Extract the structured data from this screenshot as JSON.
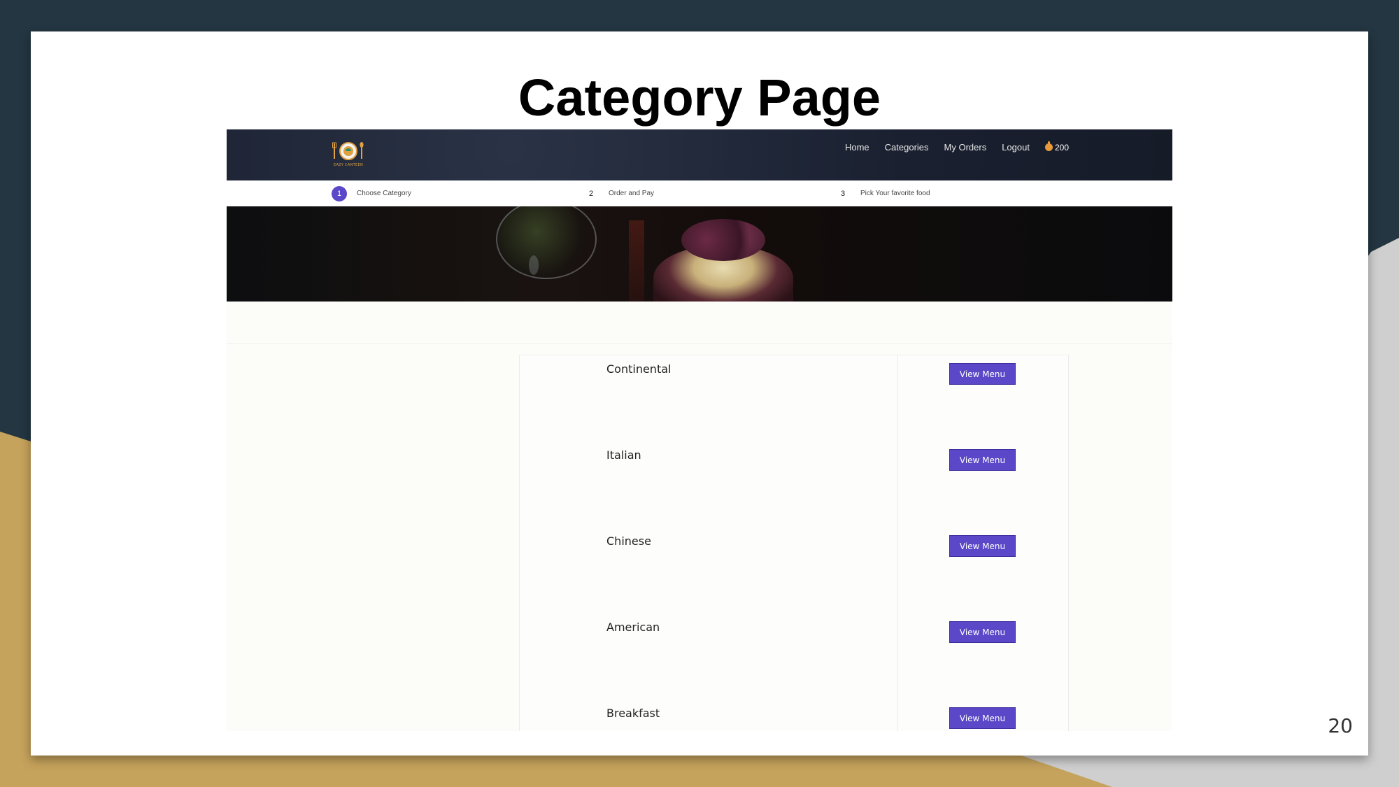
{
  "slide": {
    "title": "Category Page",
    "page_number": "20"
  },
  "app": {
    "logo_text": "EAZY CANTEEN",
    "nav": {
      "links": [
        "Home",
        "Categories",
        "My Orders",
        "Logout"
      ],
      "coins": "200"
    },
    "steps": [
      {
        "number": "1",
        "label": "Choose Category",
        "active": true
      },
      {
        "number": "2",
        "label": "Order and Pay",
        "active": false
      },
      {
        "number": "3",
        "label": "Pick Your favorite food",
        "active": false
      }
    ],
    "categories": [
      {
        "name": "Continental",
        "button": "View Menu"
      },
      {
        "name": "Italian",
        "button": "View Menu"
      },
      {
        "name": "Chinese",
        "button": "View Menu"
      },
      {
        "name": "American",
        "button": "View Menu"
      },
      {
        "name": "Breakfast",
        "button": "View Menu"
      }
    ]
  },
  "colors": {
    "accent": "#5b48c9",
    "navbar": "#1a2030",
    "frame_dark": "#233641",
    "frame_gold": "#c6a35c"
  }
}
